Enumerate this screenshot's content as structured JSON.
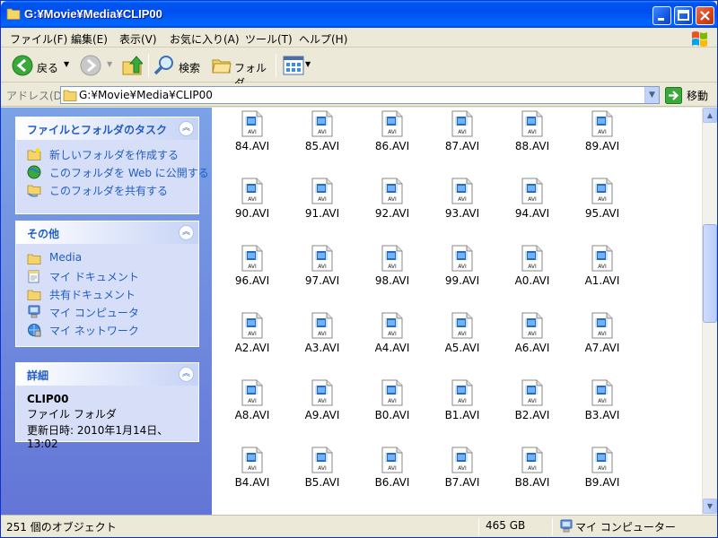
{
  "window": {
    "title": "G:¥Movie¥Media¥CLIP00"
  },
  "menu": [
    "ファイル(F)",
    "編集(E)",
    "表示(V)",
    "お気に入り(A)",
    "ツール(T)",
    "ヘルプ(H)"
  ],
  "toolbar": {
    "back_label": "戻る",
    "search_label": "検索",
    "folders_label": "フォルダ"
  },
  "address": {
    "label": "アドレス(D)",
    "value": "G:¥Movie¥Media¥CLIP00",
    "go_label": "移動"
  },
  "panels": {
    "tasks": {
      "title": "ファイルとフォルダのタスク",
      "items": [
        "新しいフォルダを作成する",
        "このフォルダを Web に公開する",
        "このフォルダを共有する"
      ]
    },
    "other": {
      "title": "その他",
      "items": [
        "Media",
        "マイ ドキュメント",
        "共有ドキュメント",
        "マイ コンピュータ",
        "マイ ネットワーク"
      ]
    },
    "details": {
      "title": "詳細",
      "name": "CLIP00",
      "type": "ファイル フォルダ",
      "modified": "更新日時: 2010年1月14日、13:02"
    }
  },
  "files": [
    "84.AVI",
    "85.AVI",
    "86.AVI",
    "87.AVI",
    "88.AVI",
    "89.AVI",
    "90.AVI",
    "91.AVI",
    "92.AVI",
    "93.AVI",
    "94.AVI",
    "95.AVI",
    "96.AVI",
    "97.AVI",
    "98.AVI",
    "99.AVI",
    "A0.AVI",
    "A1.AVI",
    "A2.AVI",
    "A3.AVI",
    "A4.AVI",
    "A5.AVI",
    "A6.AVI",
    "A7.AVI",
    "A8.AVI",
    "A9.AVI",
    "B0.AVI",
    "B1.AVI",
    "B2.AVI",
    "B3.AVI",
    "B4.AVI",
    "B5.AVI",
    "B6.AVI",
    "B7.AVI",
    "B8.AVI",
    "B9.AVI"
  ],
  "file_icon_text": "AVI",
  "status": {
    "objects": "251 個のオブジェクト",
    "size": "465 GB",
    "location": "マイ コンピューター"
  },
  "colors": {
    "titlebar": "#0053ee",
    "taskpane": "#6375d6",
    "link": "#215dc6"
  }
}
